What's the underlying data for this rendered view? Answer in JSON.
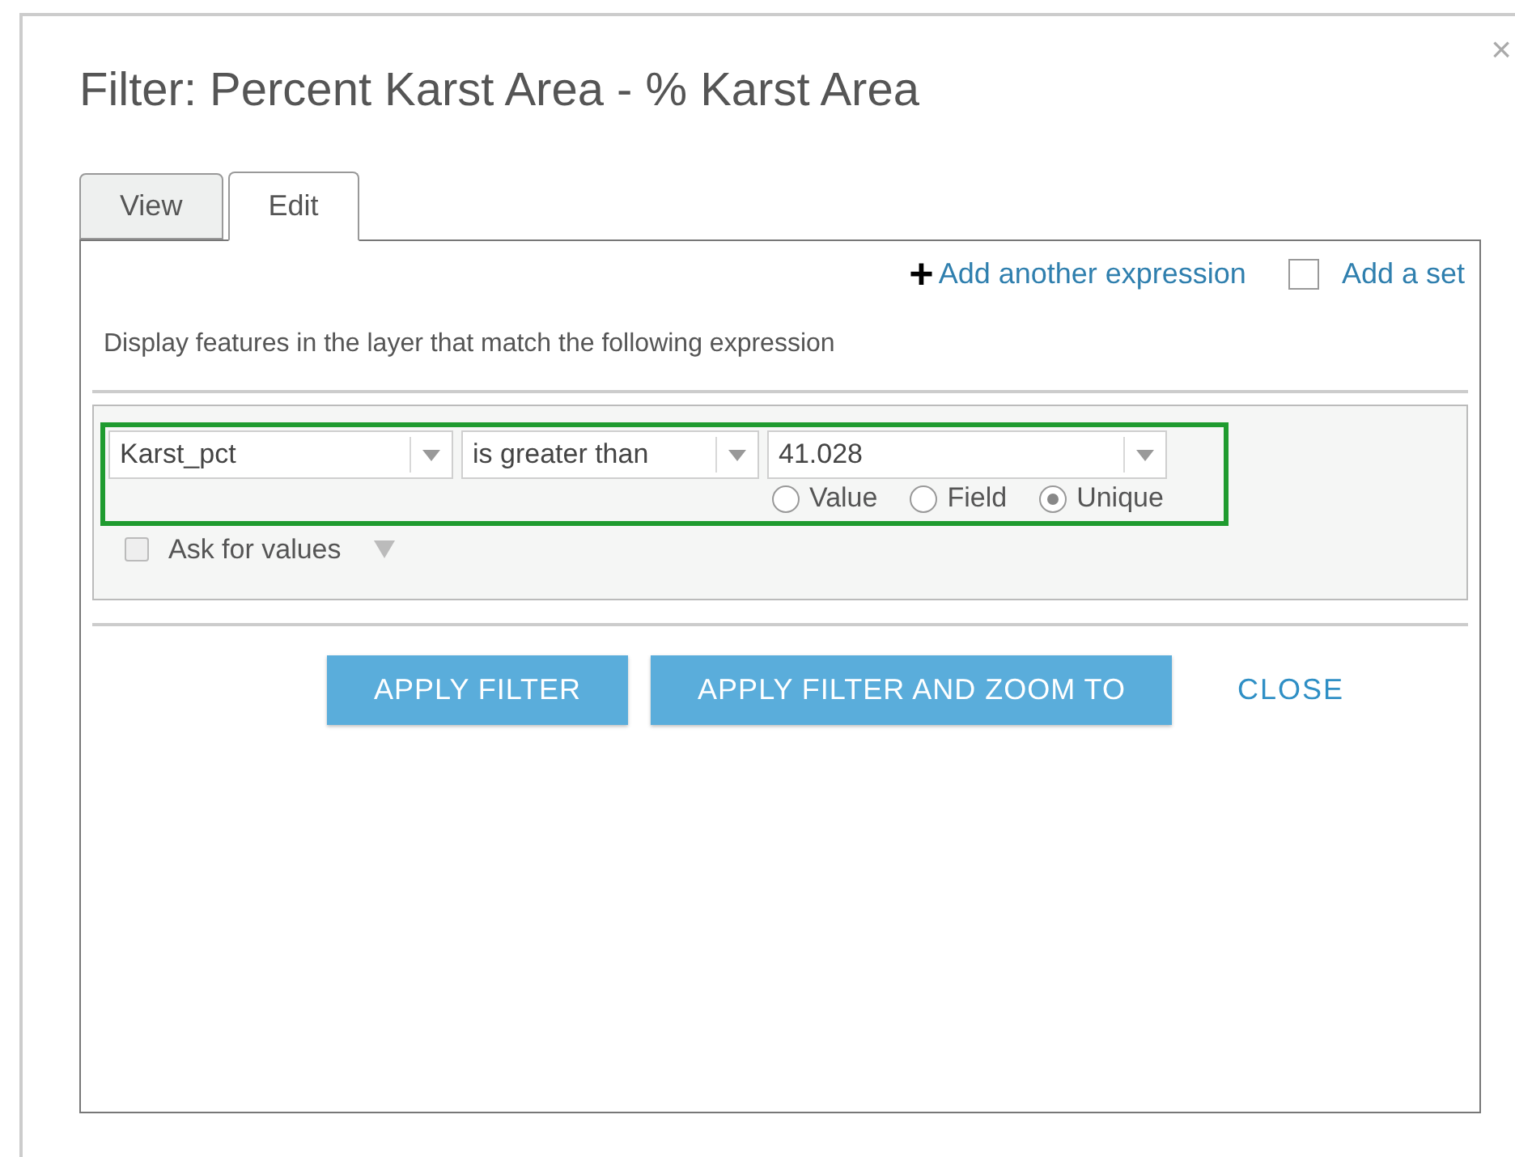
{
  "dialog": {
    "title": "Filter: Percent Karst Area - % Karst Area",
    "close": "×"
  },
  "tabs": [
    {
      "label": "View",
      "selected": false
    },
    {
      "label": "Edit",
      "selected": true
    }
  ],
  "add_expression": {
    "icon": "+",
    "label": "Add another expression"
  },
  "add_set": {
    "label": "Add a set",
    "checked": false
  },
  "description": "Display features in the layer that match the following expression",
  "expression": {
    "field": "Karst_pct",
    "operator": "is greater than",
    "value": "41.028",
    "modes": [
      {
        "label": "Value",
        "selected": false
      },
      {
        "label": "Field",
        "selected": false
      },
      {
        "label": "Unique",
        "selected": true
      }
    ],
    "ask_for_values": {
      "label": "Ask for values",
      "checked": false
    }
  },
  "buttons": [
    {
      "label": "APPLY FILTER",
      "kind": "primary"
    },
    {
      "label": "APPLY FILTER AND ZOOM TO",
      "kind": "primary"
    },
    {
      "label": "CLOSE",
      "kind": "link"
    }
  ]
}
